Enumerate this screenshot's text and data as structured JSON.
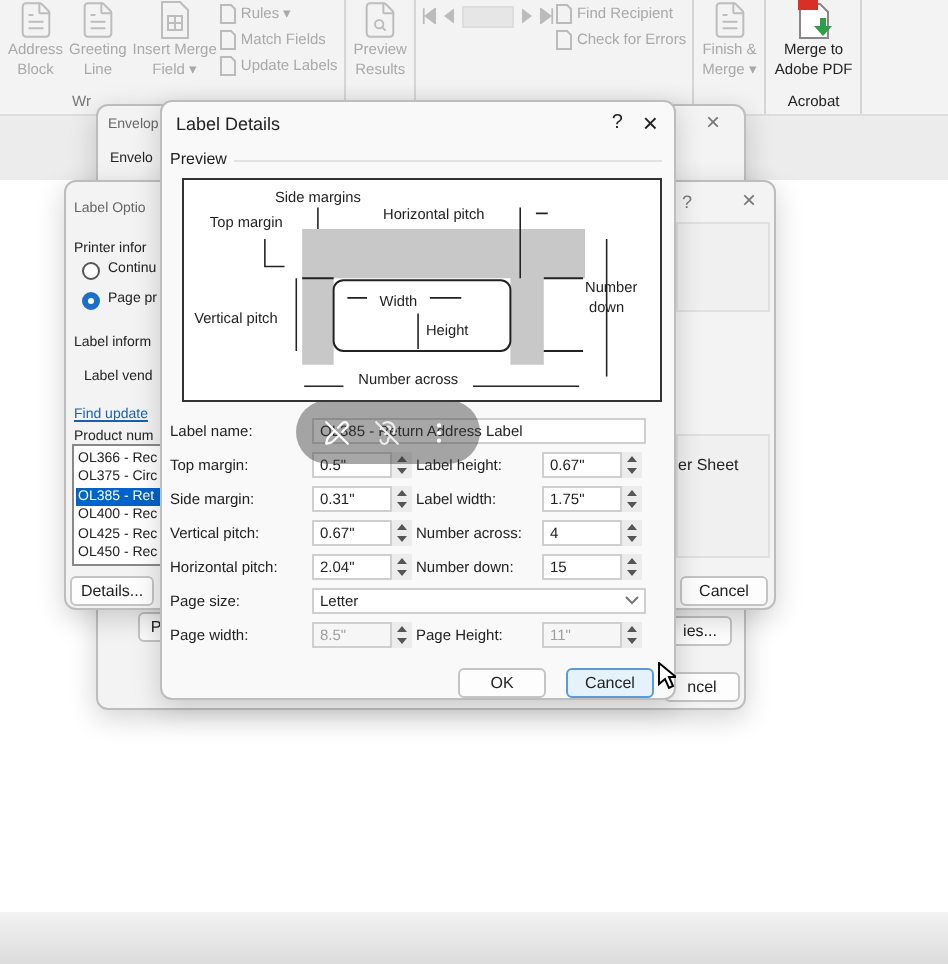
{
  "ribbon": {
    "groups": [
      {
        "disabled": true,
        "caption": "Wr",
        "items": [
          {
            "kind": "large",
            "lines": [
              "Address",
              "Block"
            ]
          },
          {
            "kind": "large",
            "lines": [
              "Greeting",
              "Line"
            ]
          },
          {
            "kind": "large",
            "lines": [
              "Insert Merge",
              "Field ▾"
            ]
          },
          {
            "kind": "stack",
            "labels": [
              "Rules ▾",
              "Match Fields",
              "Update Labels"
            ]
          }
        ]
      },
      {
        "disabled": true,
        "items": [
          {
            "kind": "large",
            "lines": [
              "Preview",
              "Results"
            ]
          }
        ]
      },
      {
        "disabled": true,
        "items": [
          {
            "kind": "nav"
          },
          {
            "kind": "stack",
            "labels": [
              "Find Recipient",
              "Check for Errors"
            ]
          }
        ]
      },
      {
        "disabled": true,
        "items": [
          {
            "kind": "large",
            "lines": [
              "Finish &",
              "Merge ▾"
            ]
          }
        ]
      },
      {
        "disabled": false,
        "caption": "Acrobat",
        "items": [
          {
            "kind": "large",
            "lines": [
              "Merge to",
              "Adobe PDF"
            ]
          }
        ]
      }
    ]
  },
  "envelopes_dialog": {
    "title": "Envelop",
    "close": "×",
    "tab": "Envelo",
    "buttons": [
      "P",
      "ies...",
      "ncel"
    ]
  },
  "label_options_dialog": {
    "title": "Label Optio",
    "help": "?",
    "close": "×",
    "printer_heading": "Printer infor",
    "radios": [
      {
        "label": "Continu",
        "selected": false
      },
      {
        "label": "Page pr",
        "selected": true
      }
    ],
    "label_heading": "Label inform",
    "vendor_label": "Label vend",
    "link": "Find update",
    "product_label": "Product num",
    "products": [
      {
        "label": "OL366 - Rec",
        "selected": false
      },
      {
        "label": "OL375 - Circ",
        "selected": false
      },
      {
        "label": "OL385 - Ret",
        "selected": true
      },
      {
        "label": "OL400 - Rec",
        "selected": false
      },
      {
        "label": "OL425 - Rec",
        "selected": false
      },
      {
        "label": "OL450 - Rec",
        "selected": false
      }
    ],
    "type_text": "er Sheet",
    "details_button": "Details...",
    "cancel_button": "Cancel"
  },
  "label_details_dialog": {
    "title": "Label Details",
    "help": "?",
    "close": "×",
    "preview_heading": "Preview",
    "diagram_labels": [
      "Side margins",
      "Top margin",
      "Horizontal pitch",
      "Number",
      "down",
      "Vertical pitch",
      "Width",
      "Height",
      "Number across"
    ],
    "rows": [
      {
        "kind": "text",
        "label": "Label name:",
        "value": "OL385 - Return Address Label"
      },
      {
        "kind": "pair",
        "left": {
          "label": "Top margin:",
          "value": "0.5\"",
          "disabled": false
        },
        "right": {
          "label": "Label height:",
          "value": "0.67\"",
          "disabled": false
        }
      },
      {
        "kind": "pair",
        "left": {
          "label": "Side margin:",
          "value": "0.31\"",
          "disabled": false
        },
        "right": {
          "label": "Label width:",
          "value": "1.75\"",
          "disabled": false
        }
      },
      {
        "kind": "pair",
        "left": {
          "label": "Vertical pitch:",
          "value": "0.67\"",
          "disabled": false
        },
        "right": {
          "label": "Number across:",
          "value": "4",
          "disabled": false
        }
      },
      {
        "kind": "pair",
        "left": {
          "label": "Horizontal pitch:",
          "value": "2.04\"",
          "disabled": false
        },
        "right": {
          "label": "Number down:",
          "value": "15",
          "disabled": false
        }
      },
      {
        "kind": "dropdown",
        "label": "Page size:",
        "value": "Letter"
      },
      {
        "kind": "pair",
        "left": {
          "label": "Page width:",
          "value": "8.5\"",
          "disabled": true
        },
        "right": {
          "label": "Page Height:",
          "value": "11\"",
          "disabled": true
        }
      }
    ],
    "buttons": [
      {
        "label": "OK",
        "focused": false
      },
      {
        "label": "Cancel",
        "focused": true
      }
    ]
  }
}
